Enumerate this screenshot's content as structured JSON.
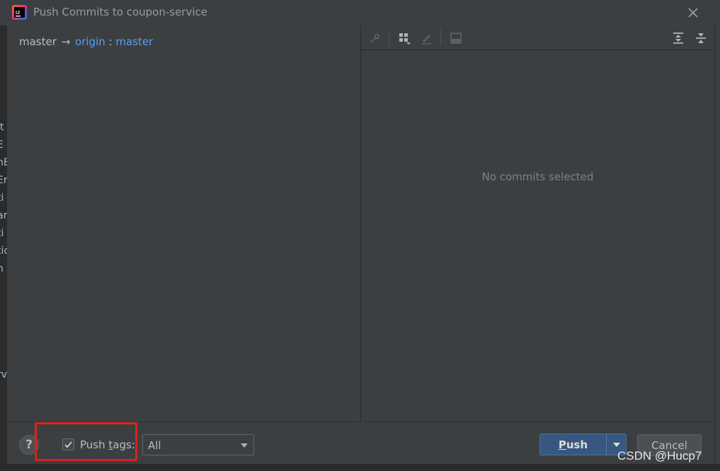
{
  "window": {
    "title": "Push Commits to coupon-service"
  },
  "background_editor": {
    "fragments": [
      "it",
      "E",
      "nE",
      "Er",
      "ti",
      "ar",
      "ti",
      "tic",
      "n",
      "rv"
    ]
  },
  "left_pane": {
    "local_branch": "master",
    "arrow": "→",
    "remote": "origin",
    "separator": " : ",
    "remote_branch": "master"
  },
  "right_pane": {
    "empty_message": "No commits selected",
    "toolbar_icons": [
      "cherry-pick-icon",
      "group-by-icon",
      "edit-icon",
      "diff-preview-icon",
      "expand-all-icon",
      "collapse-all-icon"
    ]
  },
  "footer": {
    "help_label": "?",
    "push_tags": {
      "checked": true,
      "label_pre": "Push ",
      "label_mnemonic": "t",
      "label_post": "ags:"
    },
    "tags_select": {
      "value": "All"
    },
    "push_button": {
      "mnemonic": "P",
      "rest": "ush"
    },
    "cancel_button": {
      "label": "Cancel"
    }
  },
  "watermark": "CSDN @Hucp7",
  "colors": {
    "background": "#3c3f41",
    "link": "#589df6",
    "primary_button": "#365880",
    "highlight": "#e0201b"
  }
}
